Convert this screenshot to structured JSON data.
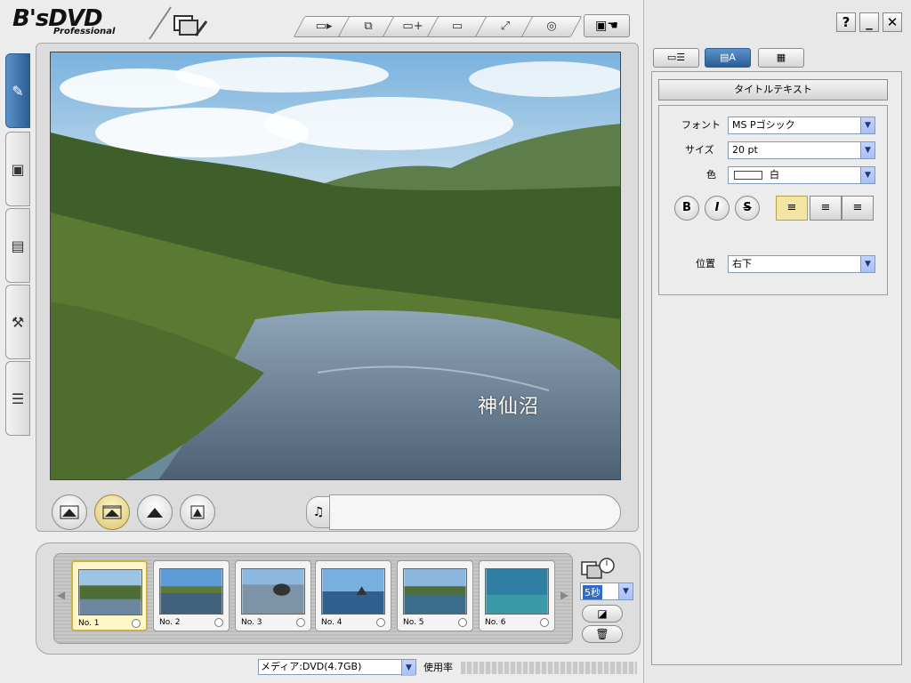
{
  "app": {
    "logo_main": "B'sDVD",
    "logo_sub": "Professional"
  },
  "toolbar": {
    "icons": [
      "export-icon",
      "copy-icon",
      "add-slide-icon",
      "delete-icon",
      "resize-icon",
      "disc-icon",
      "slideshow-settings-icon"
    ]
  },
  "window": {
    "help": "?",
    "minimize": "_",
    "close": "✕"
  },
  "side_tabs": [
    "edit-icon",
    "video-icon",
    "photo-icon",
    "tools-icon",
    "list-icon"
  ],
  "preview": {
    "caption": "神仙沼"
  },
  "display_modes": [
    "fit",
    "fill",
    "crop",
    "original"
  ],
  "thumbnails": [
    {
      "label": "No. 1"
    },
    {
      "label": "No. 2"
    },
    {
      "label": "No. 3"
    },
    {
      "label": "No. 4"
    },
    {
      "label": "No. 5"
    },
    {
      "label": "No. 6"
    }
  ],
  "duration": {
    "value": "5秒"
  },
  "media": {
    "selected": "メディア:DVD(4.7GB)",
    "usage_label": "使用率"
  },
  "right": {
    "section_title": "タイトルテキスト",
    "font_label": "フォント",
    "font_value": "MS Pゴシック",
    "size_label": "サイズ",
    "size_value": "20 pt",
    "color_label": "色",
    "color_value": "白",
    "position_label": "位置",
    "position_value": "右下",
    "bold": "B",
    "italic": "I",
    "strike": "S"
  },
  "colors": {
    "accent": "#2b5d93",
    "selected": "#f3e6a4"
  }
}
